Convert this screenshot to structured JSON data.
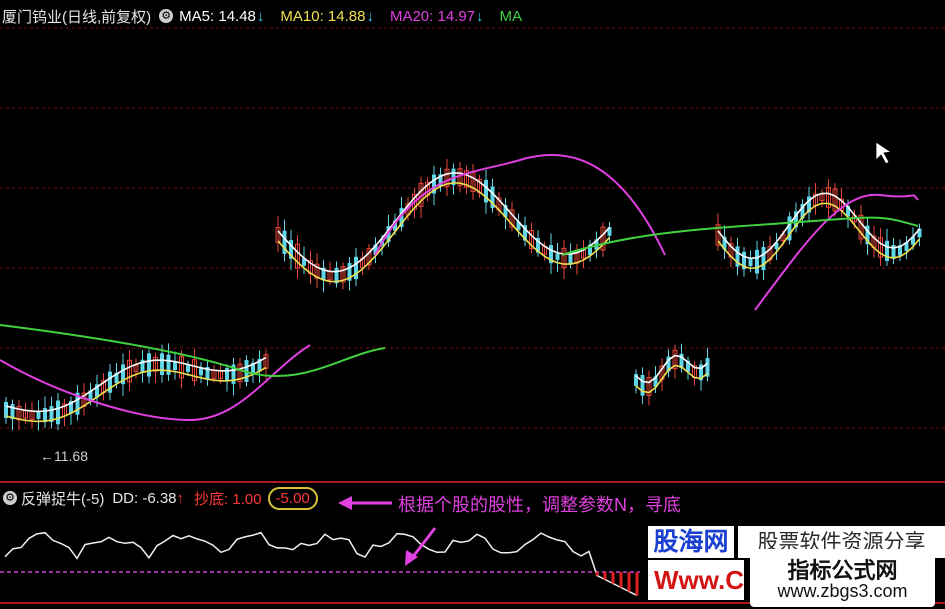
{
  "header": {
    "title": "厦门钨业(日线,前复权)",
    "ma": [
      {
        "label": "MA5: 14.48",
        "arrow": "↓",
        "color": "#ffffff"
      },
      {
        "label": "MA10: 14.88",
        "arrow": "↓",
        "color": "#f0e050"
      },
      {
        "label": "MA20: 14.97",
        "arrow": "↓",
        "color": "#e040e0"
      },
      {
        "label": "MA",
        "arrow": "",
        "color": "#40d040"
      }
    ]
  },
  "low_label": "←11.68",
  "indicator": {
    "name": "反弹捉牛(-5)",
    "dd_label": "DD: -6.38",
    "dd_arrow": "↑",
    "chaodi_label": "抄底: 1.00",
    "param_value": "-5.00"
  },
  "annotation": "根据个股的股性，调整参数N，寻底",
  "watermarks": {
    "logo_blue": "股海网",
    "banner": "股票软件资源分享",
    "logo_red": "Www.C",
    "badge_title": "指标公式网",
    "badge_url": "www.zbgs3.com"
  },
  "colors": {
    "up": "#e8463a",
    "down": "#5fd6e8",
    "ma5": "#ffffff",
    "ma10": "#f0e050",
    "ma20": "#e040e0",
    "ma60": "#40d040",
    "grid": "#7a1010"
  }
}
